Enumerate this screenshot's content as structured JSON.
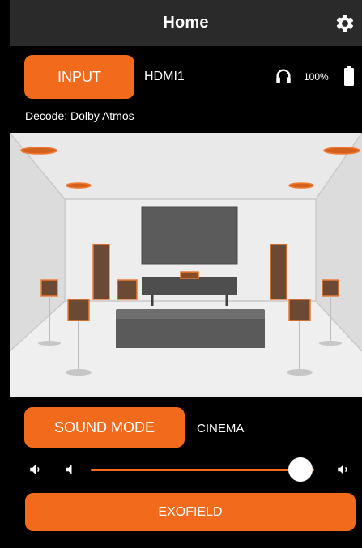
{
  "header": {
    "title": "Home",
    "settings_icon": "gear-icon"
  },
  "input": {
    "button_label": "INPUT",
    "value": "HDMI1"
  },
  "status": {
    "headphones_icon": "headphones-icon",
    "battery_percent": "100%",
    "battery_icon": "battery-icon",
    "battery_level": 1.0
  },
  "decode": {
    "text": "Decode: Dolby Atmos"
  },
  "room_image": {
    "description_icon": "speaker-room-illustration"
  },
  "sound_mode": {
    "button_label": "SOUND MODE",
    "value": "CINEMA"
  },
  "volume": {
    "level": 0.94,
    "mute_icon": "speaker-icon",
    "down_icon": "volume-down-icon",
    "up_icon": "volume-up-icon"
  },
  "exofield": {
    "button_label": "EXOFIELD"
  },
  "colors": {
    "accent": "#f26b1d",
    "header_bg": "#2a2a2a",
    "background": "#000000",
    "room_bg": "#e6e6e6"
  }
}
